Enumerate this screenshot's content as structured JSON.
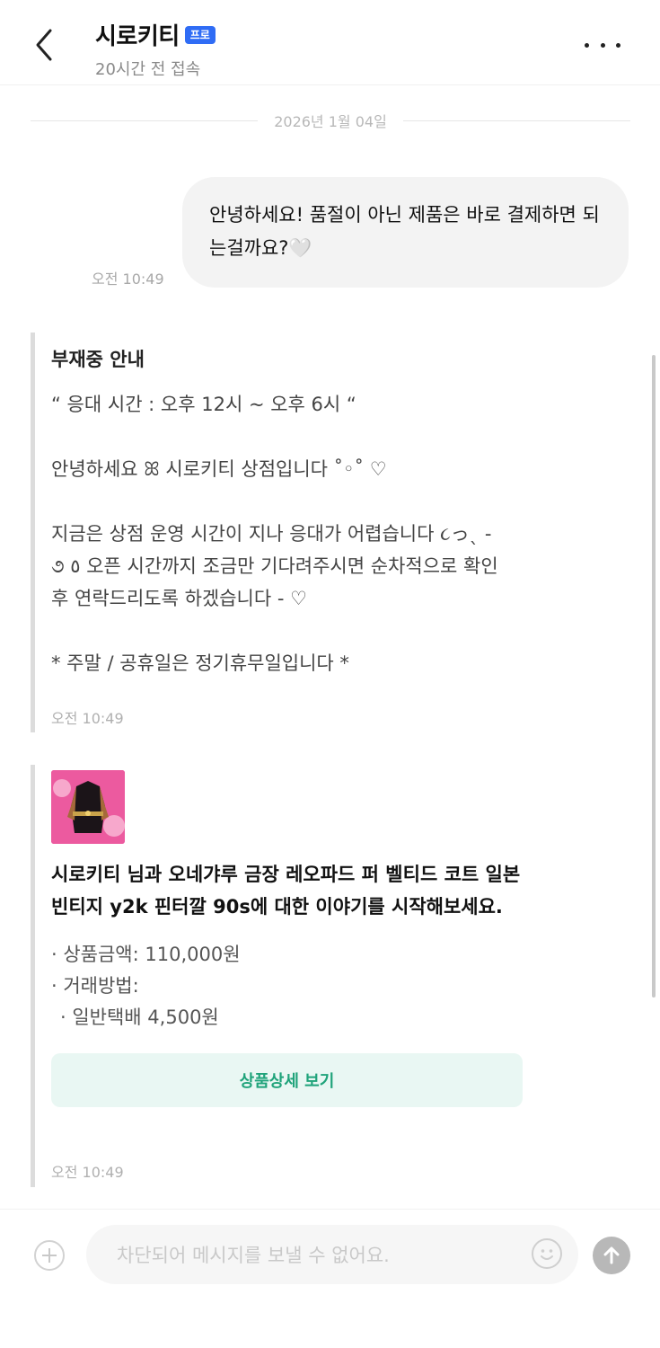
{
  "header": {
    "title": "시로키티",
    "badge": "프로",
    "subtitle": "20시간 전 접속"
  },
  "date_divider": "2026년 1월 04일",
  "outgoing": {
    "text": "안녕하세요! 품절이 아닌 제품은 바로 결제하면 되는걸까요?🤍",
    "time": "오전 10:49"
  },
  "away_notice": {
    "heading": "부재중 안내",
    "body": "“ 응대 시간 : 오후 12시 ~ 오후 6시 “\n\n안녕하세요 ꕤ 시로키티 상점입니다 ˚◦˚ ♡\n\n지금은 상점 운영 시간이 지나 응대가 어렵습니다 ૮っˎ -\n૭ ٥ 오픈 시간까지 조금만 기다려주시면 순차적으로 확인\n후 연락드리도록 하겠습니다 - ♡\n\n* 주말 / 공휴일은 정기휴무일입니다 *",
    "time": "오전 10:49"
  },
  "product_card": {
    "title": "시로키티 님과 오네갸루 금장 레오파드 퍼 벨티드 코트 일본빈티지 y2k 핀터깔 90s에 대한 이야기를 시작해보세요.",
    "price": "· 상품금액: 110,000원",
    "method_label": "· 거래방법:",
    "method_value": "· 일반택배 4,500원",
    "button": "상품상세 보기",
    "time": "오전 10:49"
  },
  "input": {
    "placeholder": "차단되어 메시지를 보낼 수 없어요."
  },
  "colors": {
    "badge": "#2f6cf5",
    "button_text": "#1fa37a",
    "button_bg": "#e9f7f3"
  }
}
